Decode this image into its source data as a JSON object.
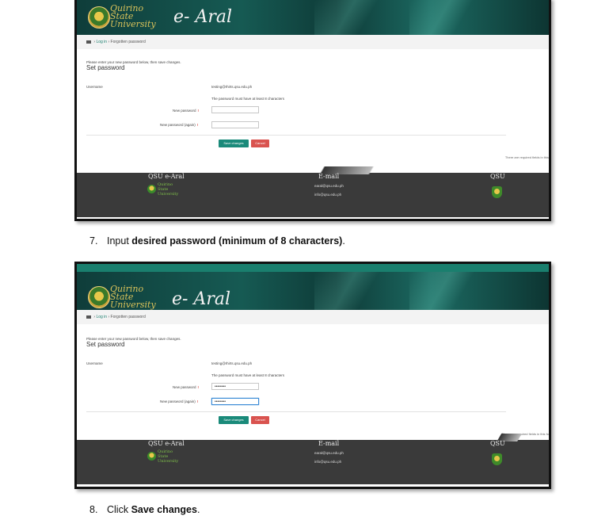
{
  "screens": [
    {
      "university_name": [
        "Quirino",
        "State",
        "University"
      ],
      "brand": "e- Aral",
      "breadcrumb": {
        "items": [
          "Log in",
          "Forgotten password"
        ]
      },
      "form": {
        "intro": "Please enter your new password below, then save changes.",
        "heading": "Set password",
        "username_label": "Username",
        "username_value": "testing@Ihirts.qsu.edu.ph",
        "rule_note": "The password must have at least 8 characters",
        "new_password_label": "New password",
        "new_password_again_label": "New password (again)",
        "new_password_value": "",
        "new_password_again_value": "",
        "save_label": "Save changes",
        "cancel_label": "Cancel",
        "required_note": "There are required fields in this"
      },
      "footer": {
        "col1_title": "QSU e-Aral",
        "col2_title": "E-mail",
        "col3_title": "QSU",
        "emails": [
          "earal@qsu.edu.ph",
          "info@qsu.edu.ph"
        ],
        "logo_text": [
          "Quirino",
          "State",
          "University"
        ]
      }
    },
    {
      "university_name": [
        "Quirino",
        "State",
        "University"
      ],
      "brand": "e- Aral",
      "breadcrumb": {
        "items": [
          "Log in",
          "Forgotten password"
        ]
      },
      "form": {
        "intro": "Please enter your new password below, then save changes.",
        "heading": "Set password",
        "username_label": "Username",
        "username_value": "testing@Ihirts.qsu.edu.ph",
        "rule_note": "The password must have at least 8 characters",
        "new_password_label": "New password",
        "new_password_again_label": "New password (again)",
        "new_password_value": "••••••••",
        "new_password_again_value": "••••••••",
        "save_label": "Save changes",
        "cancel_label": "Cancel",
        "required_note": "There are required fields in this fo"
      },
      "footer": {
        "col1_title": "QSU e-Aral",
        "col2_title": "E-mail",
        "col3_title": "QSU",
        "emails": [
          "earal@qsu.edu.ph",
          "info@qsu.edu.ph"
        ],
        "logo_text": [
          "Quirino",
          "State",
          "University"
        ]
      }
    }
  ],
  "steps": [
    {
      "number": "7.",
      "prefix": "Input ",
      "bold": "desired password (minimum of 8 characters)",
      "suffix": "."
    },
    {
      "number": "8.",
      "prefix": "Click ",
      "bold": "Save changes",
      "suffix": "."
    }
  ]
}
